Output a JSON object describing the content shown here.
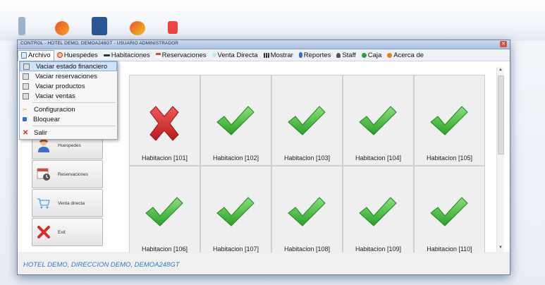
{
  "window": {
    "title": "CONTROL - HOTEL DEMO, DEMOA248GT - USUARIO ADMINISTRADOR",
    "close_glyph": "✕"
  },
  "menu": {
    "items": [
      {
        "label": "Archivo",
        "icon": "folder-icon",
        "color": "#4a7bbd"
      },
      {
        "label": "Huespedes",
        "icon": "person-icon",
        "color": "#c0392b"
      },
      {
        "label": "Habitaciones",
        "icon": "bed-icon",
        "color": "#333333"
      },
      {
        "label": "Reservaciones",
        "icon": "calendar-icon",
        "color": "#d9473b"
      },
      {
        "label": "Venta Directa",
        "icon": "cart-icon",
        "color": "#48a9e6"
      },
      {
        "label": "Mostrar",
        "icon": "grid-icon",
        "color": "#333333"
      },
      {
        "label": "Reportes",
        "icon": "report-icon",
        "color": "#3a6fc4"
      },
      {
        "label": "Staff",
        "icon": "staff-icon",
        "color": "#444444"
      },
      {
        "label": "Caja",
        "icon": "cash-icon",
        "color": "#2e9e3e"
      },
      {
        "label": "Acerca de",
        "icon": "info-icon",
        "color": "#e67e22"
      }
    ]
  },
  "archivo_menu": {
    "items": [
      {
        "label": "Vaciar estado financiero"
      },
      {
        "label": "Vaciar reservaciones"
      },
      {
        "label": "Vaciar productos"
      },
      {
        "label": "Vaciar ventas"
      },
      {
        "label": "Configuracion"
      },
      {
        "label": "Bloquear"
      },
      {
        "label": "Salir"
      }
    ]
  },
  "sidebar": {
    "buttons": [
      {
        "label": "Huespedes",
        "icon": "guest-icon"
      },
      {
        "label": "Reservaciones",
        "icon": "calendar-clock-icon"
      },
      {
        "label": "Venta directa",
        "icon": "cart-icon"
      },
      {
        "label": "Exit",
        "icon": "exit-x-icon"
      }
    ]
  },
  "rooms": [
    {
      "label": "Habitacion [101]",
      "status": "occupied"
    },
    {
      "label": "Habitacion [102]",
      "status": "available"
    },
    {
      "label": "Habitacion [103]",
      "status": "available"
    },
    {
      "label": "Habitacion [104]",
      "status": "available"
    },
    {
      "label": "Habitacion [105]",
      "status": "available"
    },
    {
      "label": "Habitacion [106]",
      "status": "available"
    },
    {
      "label": "Habitacion [107]",
      "status": "available"
    },
    {
      "label": "Habitacion [108]",
      "status": "available"
    },
    {
      "label": "Habitacion [109]",
      "status": "available"
    },
    {
      "label": "Habitacion [110]",
      "status": "available"
    }
  ],
  "status_bar": {
    "text": "HOTEL DEMO, DIRECCION DEMO, DEMOA248GT"
  },
  "colors": {
    "check_green": "#3fbf3f",
    "cross_red": "#d62c2c",
    "status_text": "#3178c6"
  }
}
